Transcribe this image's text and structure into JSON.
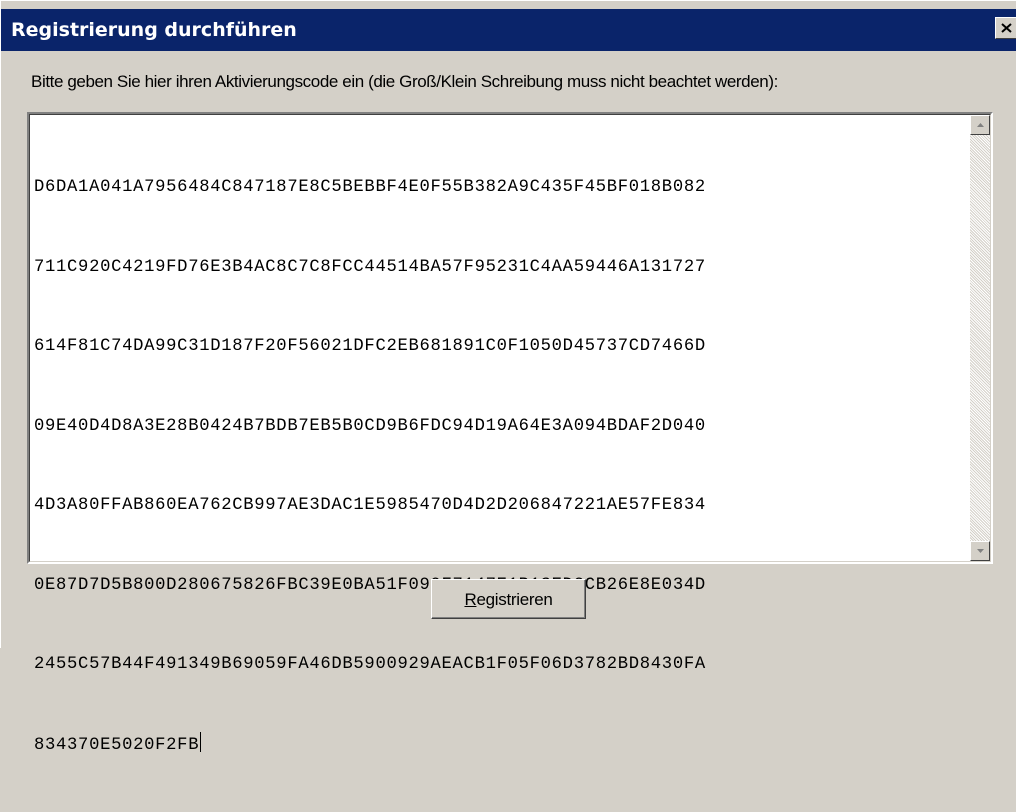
{
  "window": {
    "title": "Registrierung durchführen"
  },
  "instruction": "Bitte geben Sie hier ihren Aktivierungscode ein (die Groß/Klein Schreibung muss nicht beachtet werden):",
  "activation_code": {
    "lines": [
      "D6DA1A041A7956484C847187E8C5BEBBF4E0F55B382A9C435F45BF018B082",
      "711C920C4219FD76E3B4AC8C7C8FCC44514BA57F95231C4AA59446A131727",
      "614F81C74DA99C31D187F20F56021DFC2EB681891C0F1050D45737CD7466D",
      "09E40D4D8A3E28B0424B7BDB7EB5B0CD9B6FDC94D19A64E3A094BDAF2D040",
      "4D3A80FFAB860EA762CB997AE3DAC1E5985470D4D2D206847221AE57FE834",
      "0E87D7D5B800D280675826FBC39E0BA51F099F7147E1B13ED2CB26E8E034D",
      "2455C57B44F491349B69059FA46DB5900929AEACB1F05F06D3782BD8430FA",
      "834370E5020F2FB"
    ]
  },
  "register_button": {
    "accel": "R",
    "rest": "egistrieren"
  },
  "icons": {
    "close": "close-icon",
    "scroll_up": "scroll-up-arrow-icon",
    "scroll_down": "scroll-down-arrow-icon"
  },
  "colors": {
    "titlebar": "#0a246a",
    "title_text": "#ffffff",
    "dialog_bg": "#d4d0c8"
  }
}
